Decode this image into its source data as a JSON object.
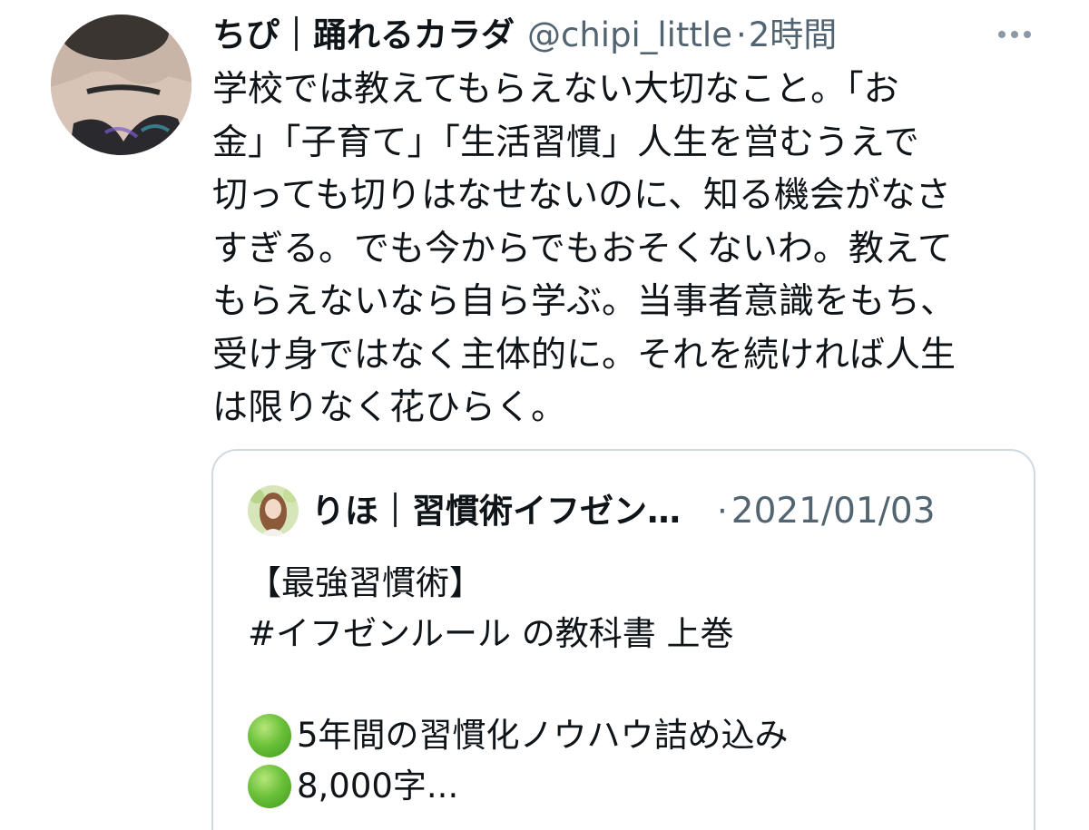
{
  "tweet": {
    "display_name": "ちぴ｜踊れるカラダ",
    "handle": "@chipi_little",
    "separator": "·",
    "time": "2時間",
    "more_icon": "more-horizontal-icon",
    "text_lines": [
      "学校では教えてもらえない大切なこと。「お",
      "金」「子育て」「生活習慣」人生を営むうえで",
      "切っても切りはなせないのに、知る機会がなさ",
      "すぎる。でも今からでもおそくないわ。教えて",
      "もらえないなら自ら学ぶ。当事者意識をもち、",
      "受け身ではなく主体的に。それを続ければ人生",
      "は限りなく花ひらく。"
    ]
  },
  "quoted_tweet": {
    "display_name": "りほ｜習慣術イフゼン…",
    "separator": "·",
    "date": "2021/01/03",
    "lines": [
      {
        "bullet": false,
        "text": "【最強習慣術】"
      },
      {
        "bullet": false,
        "text": "#イフゼンルール の教科書 上巻"
      },
      {
        "bullet": false,
        "text": ""
      },
      {
        "bullet": true,
        "text": "5年間の習慣化ノウハウ詰め込み"
      },
      {
        "bullet": true,
        "text": "8,000字..."
      }
    ]
  },
  "colors": {
    "text_primary": "#0f1419",
    "text_secondary": "#536471",
    "border": "#cfd9de",
    "bullet_green": "#6cc13a"
  }
}
